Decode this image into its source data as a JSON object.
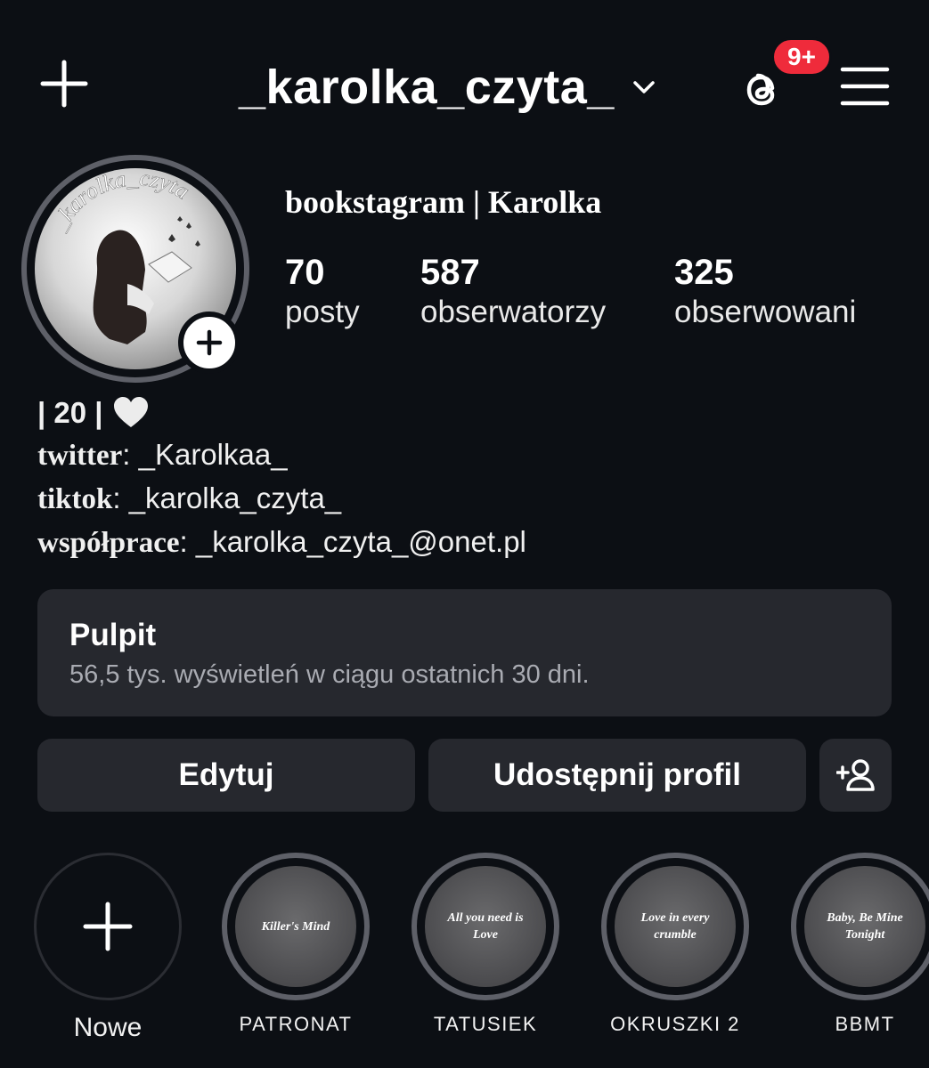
{
  "header": {
    "username": "_karolka_czyta_",
    "notification_badge": "9+"
  },
  "profile": {
    "avatar_text": "_karolka_czyta",
    "display_name": "bookstagram | Karolka",
    "stats": [
      {
        "value": "70",
        "label": "posty"
      },
      {
        "value": "587",
        "label": "obserwatorzy"
      },
      {
        "value": "325",
        "label": "obserwowani"
      }
    ]
  },
  "bio": {
    "line1": "| 20 |",
    "twitter_key": "twitter",
    "twitter_value": ": _Karolkaa_",
    "tiktok_key": "tiktok",
    "tiktok_value": ": _karolka_czyta_",
    "collab_key": "współprace",
    "collab_value": ": _karolka_czyta_@onet.pl"
  },
  "dashboard": {
    "title": "Pulpit",
    "subtitle": "56,5 tys. wyświetleń w ciągu ostatnich 30 dni."
  },
  "buttons": {
    "edit": "Edytuj",
    "share": "Udostępnij profil"
  },
  "highlights": [
    {
      "label": "Nowe",
      "cover": ""
    },
    {
      "label": "PATRONAT",
      "cover": "Killer's Mind"
    },
    {
      "label": "TATUSIEK",
      "cover": "All you need is Love"
    },
    {
      "label": "OKRUSZKI 2",
      "cover": "Love in every crumble"
    },
    {
      "label": "BBMT",
      "cover": "Baby, Be Mine Tonight"
    }
  ],
  "colors": {
    "background": "#0c0f14",
    "card": "#26282e",
    "badge": "#ef2b3b",
    "ring": "#5e6068"
  },
  "icons": [
    "plus-icon",
    "chevron-down-icon",
    "threads-icon",
    "menu-icon",
    "heart-icon",
    "add-person-icon"
  ]
}
